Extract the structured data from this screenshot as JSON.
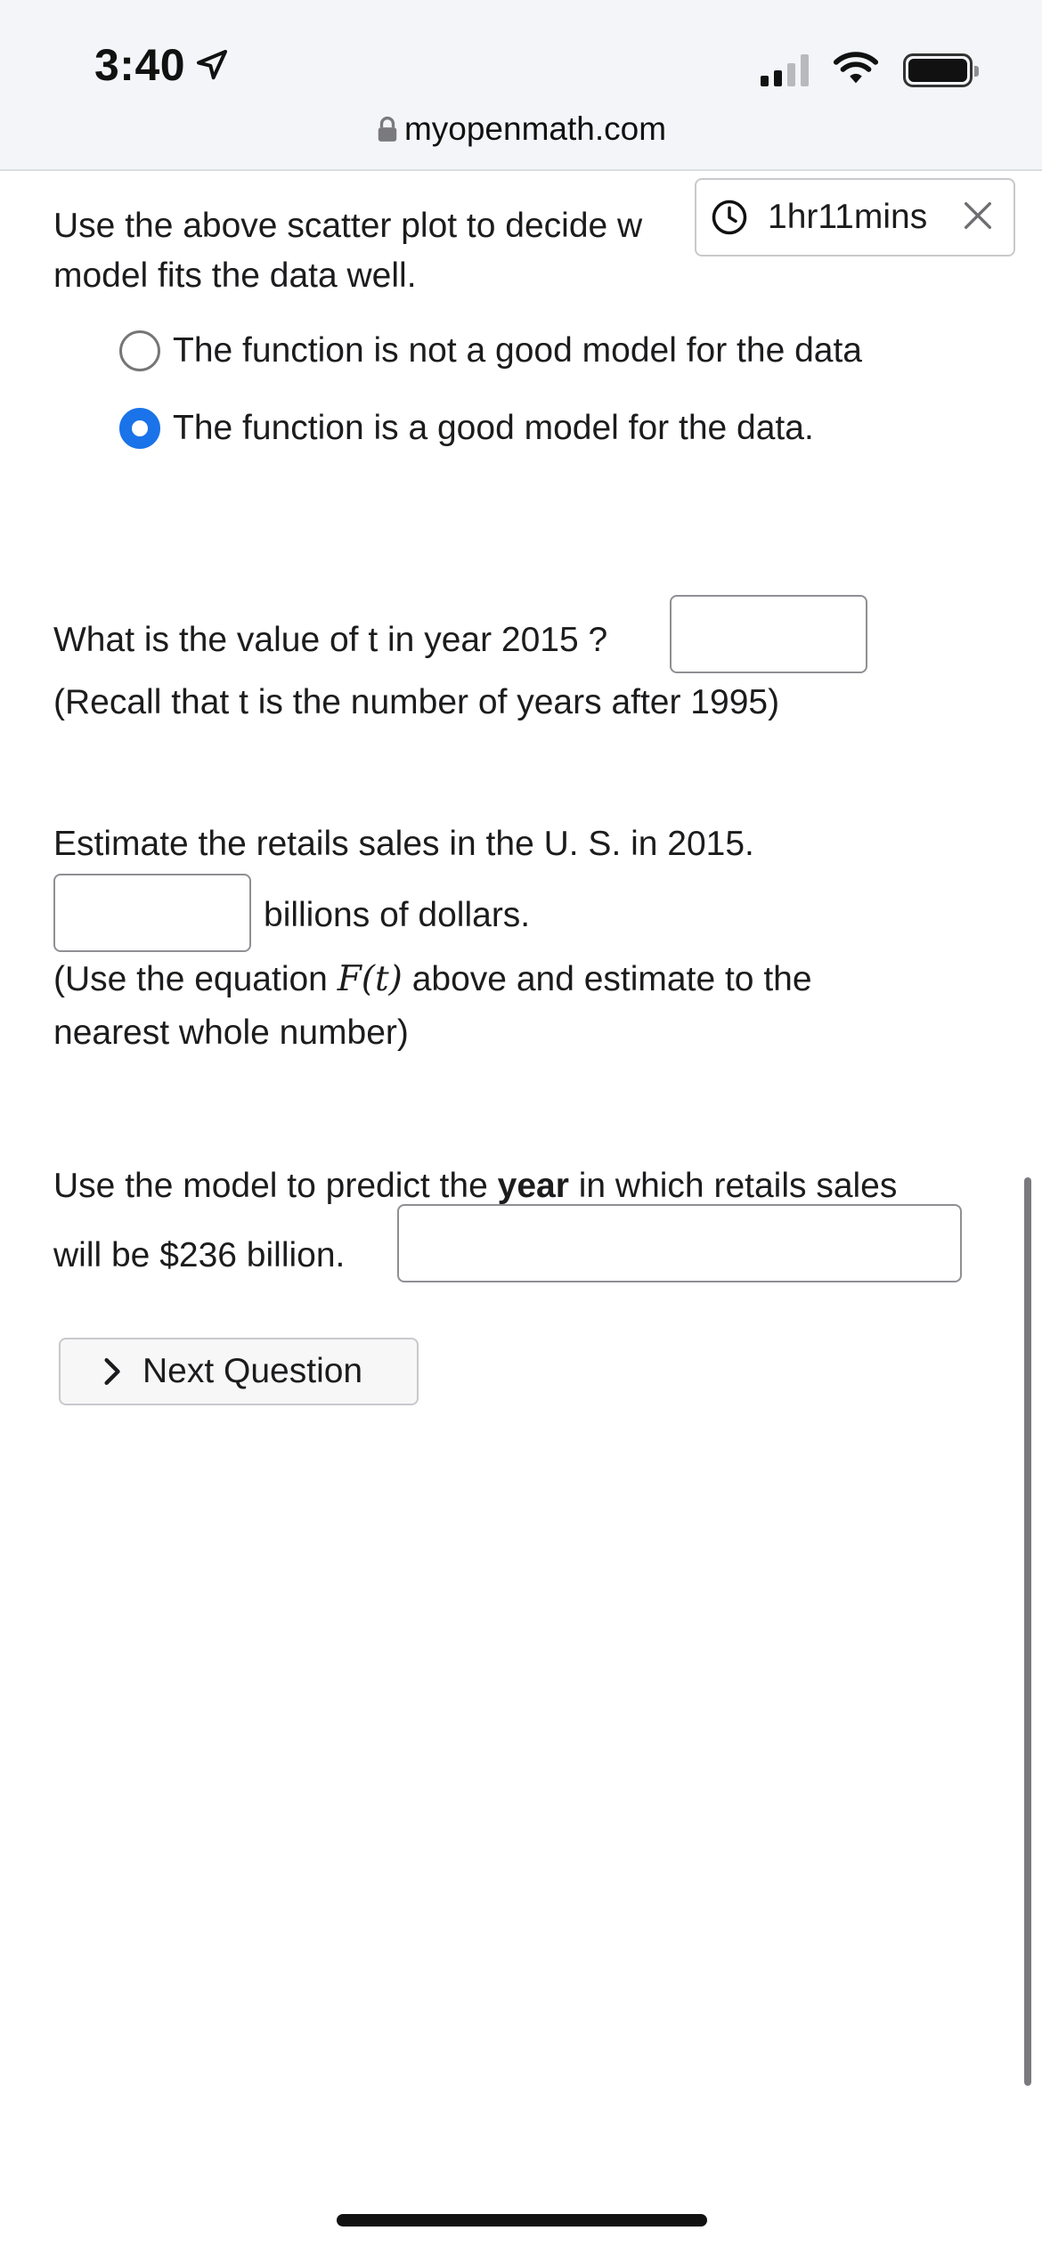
{
  "status_bar": {
    "time": "3:40"
  },
  "browser": {
    "url": "myopenmath.com"
  },
  "timer": {
    "label": "1hr11mins"
  },
  "question": {
    "fit_prompt_line1": "Use the above scatter plot to decide w",
    "fit_prompt_line2": "model fits the data well.",
    "options": [
      {
        "label": "The function is not a good model for the data",
        "selected": false
      },
      {
        "label": "The function is a good model for the data.",
        "selected": true
      }
    ],
    "t_prompt": "What is the value of t in year 2015 ?",
    "t_recall": "(Recall that t is the number of years after 1995)",
    "estimate_prompt": "Estimate the retails sales in the U. S. in 2015.",
    "estimate_unit": "billions of dollars.",
    "estimate_hint_pre": "(Use the equation",
    "estimate_hint_math": "F(t)",
    "estimate_hint_post": "above and estimate to the",
    "estimate_hint_line2": "nearest whole number)",
    "predict_pre": "Use the model to predict the",
    "predict_bold": "year",
    "predict_post": "in which retails sales",
    "predict_line2": "will be $236 billion.",
    "t_value": "",
    "estimate_value": "",
    "predict_value": ""
  },
  "next_button": {
    "label": "Next Question"
  }
}
